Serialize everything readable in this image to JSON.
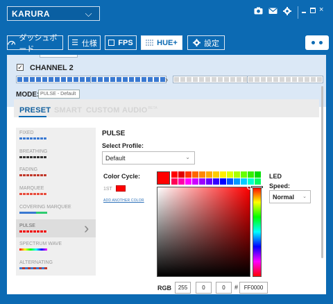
{
  "header": {
    "device_name": "KARURA",
    "chevron": "⌵",
    "icons": [
      "camera-icon",
      "mail-icon",
      "gear-icon",
      "minimize-icon",
      "restore-icon",
      "close-icon"
    ]
  },
  "nav": {
    "tabs": [
      {
        "label": "ダッシュボード",
        "icon": "dashboard-gauge-icon"
      },
      {
        "label": "仕様",
        "icon": "list-icon"
      },
      {
        "label": "FPS",
        "icon": "fps-square-icon"
      },
      {
        "label": "HUE+",
        "icon": "grid-icon"
      },
      {
        "label": "設定",
        "icon": "settings-gear-icon"
      }
    ],
    "active_tab": "HUE+"
  },
  "channel": {
    "label": "CHANNEL 2",
    "checked": true,
    "mode_label": "MODE:",
    "mode_value": "PULSE - Default",
    "led_groups_on": 2,
    "led_groups_total": 4,
    "led_on_color": "#3a79d1"
  },
  "tabs": {
    "items": [
      "PRESET",
      "SMART",
      "CUSTOM",
      "AUDIO"
    ],
    "beta": "BETA",
    "active": "PRESET"
  },
  "effects": [
    {
      "name": "FIXED"
    },
    {
      "name": "BREATHING"
    },
    {
      "name": "FADING"
    },
    {
      "name": "MARQUEE"
    },
    {
      "name": "COVERING MARQUEE"
    },
    {
      "name": "PULSE",
      "selected": true
    },
    {
      "name": "SPECTRUM WAVE"
    },
    {
      "name": "ALTERNATING"
    }
  ],
  "pulse": {
    "title": "PULSE",
    "select_profile_label": "Select Profile:",
    "profile_value": "Default",
    "color_cycle_label": "Color Cycle:",
    "first_label": "1ST",
    "first_color": "#ff0000",
    "add_color": "ADD ANOTHER COLOR"
  },
  "led": {
    "label": "LED",
    "speed_label": "Speed:",
    "speed_value": "Normal"
  },
  "picker": {
    "current_color": "#ff0000",
    "rgb_label": "RGB",
    "r": "255",
    "g": "0",
    "b": "0",
    "hash": "#",
    "hex": "FF0000",
    "palette": [
      "#ff0000",
      "#e00000",
      "#ff3300",
      "#ff6600",
      "#ff8800",
      "#ffaa00",
      "#ffcc00",
      "#ffee00",
      "#ddff00",
      "#aaff00",
      "#66ff00",
      "#33ee00",
      "#00dd00",
      "#ff0055",
      "#ff00aa",
      "#ff00ff",
      "#cc00ff",
      "#9900ff",
      "#6600ff",
      "#3300ff",
      "#0000ff",
      "#0055ff",
      "#0099ff",
      "#00ccff",
      "#00ffcc",
      "#00ff66"
    ]
  },
  "controls": {
    "dropdown_chevron": "⌄"
  }
}
